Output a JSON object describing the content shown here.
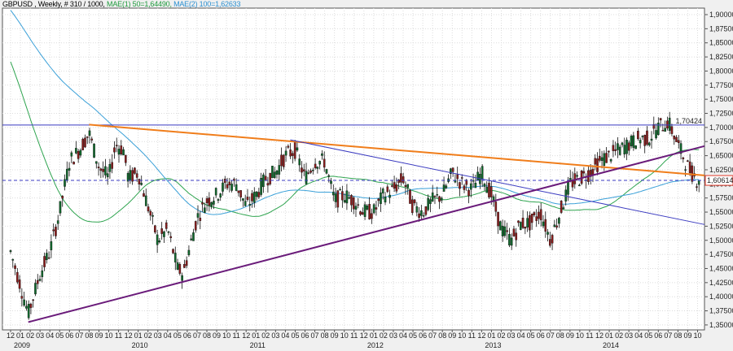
{
  "header": {
    "symbol_info": "GBPUSD , Weekly, # 310 / 1000,",
    "ma1_label": "MAE(1) 50=1,64490,",
    "ma2_label": "MAE(2) 100=1,62633"
  },
  "colors": {
    "bull": "#0f6a2c",
    "bear": "#8a1c1c",
    "ma1": "#2ea44f",
    "ma2": "#3aa0d8",
    "orange": "#f07d1a",
    "purple": "#6a1b7a",
    "blue_line": "#3a3ac0",
    "price_box": "#e03a2a"
  },
  "chart_data": {
    "type": "candlestick",
    "title": "GBPUSD , Weekly",
    "ylim": [
      1.35,
      1.9
    ],
    "y_ticks": [
      "1,35000",
      "1,37500",
      "1,40000",
      "1,42500",
      "1,45000",
      "1,47500",
      "1,50000",
      "1,52500",
      "1,55000",
      "1,57500",
      "1,60000",
      "1,62500",
      "1,65000",
      "1,67500",
      "1,70000",
      "1,72500",
      "1,75000",
      "1,77500",
      "1,80000",
      "1,82500",
      "1,85000",
      "1,87500",
      "1,90000"
    ],
    "x_month_labels": [
      "12",
      "01",
      "02",
      "03",
      "04",
      "05",
      "06",
      "07",
      "08",
      "09",
      "10",
      "11",
      "12",
      "01",
      "02",
      "03",
      "04",
      "05",
      "06",
      "07",
      "08",
      "09",
      "10",
      "11",
      "12",
      "01",
      "02",
      "03",
      "04",
      "05",
      "06",
      "07",
      "08",
      "09",
      "10",
      "11",
      "12",
      "01",
      "02",
      "03",
      "04",
      "05",
      "06",
      "07",
      "08",
      "09",
      "10",
      "11",
      "12",
      "01",
      "02",
      "03",
      "04",
      "05",
      "06",
      "07",
      "08",
      "09",
      "10",
      "11",
      "12",
      "01",
      "02",
      "03",
      "04",
      "05",
      "06",
      "07",
      "08",
      "09",
      "10"
    ],
    "x_year_labels": [
      {
        "label": "2009",
        "month_index": 1
      },
      {
        "label": "2010",
        "month_index": 13
      },
      {
        "label": "2011",
        "month_index": 25
      },
      {
        "label": "2012",
        "month_index": 37
      },
      {
        "label": "2013",
        "month_index": 49
      },
      {
        "label": "2014",
        "month_index": 61
      }
    ],
    "prehistory_closes": [
      [
        -14,
        2.0
      ],
      [
        -10,
        1.99
      ],
      [
        -7,
        1.98
      ],
      [
        -5,
        1.86
      ],
      [
        -3,
        1.7
      ],
      [
        -2,
        1.58
      ],
      [
        -1,
        1.5
      ]
    ],
    "keypoints": [
      [
        0,
        1.48
      ],
      [
        1,
        1.42
      ],
      [
        1.8,
        1.37
      ],
      [
        3,
        1.44
      ],
      [
        4,
        1.48
      ],
      [
        5,
        1.55
      ],
      [
        6,
        1.64
      ],
      [
        7,
        1.66
      ],
      [
        8,
        1.69
      ],
      [
        9,
        1.63
      ],
      [
        10,
        1.61
      ],
      [
        10.7,
        1.67
      ],
      [
        11.5,
        1.66
      ],
      [
        12,
        1.61
      ],
      [
        13,
        1.62
      ],
      [
        14,
        1.56
      ],
      [
        15,
        1.5
      ],
      [
        16,
        1.52
      ],
      [
        17,
        1.45
      ],
      [
        17.6,
        1.44
      ],
      [
        18,
        1.47
      ],
      [
        19,
        1.54
      ],
      [
        20,
        1.57
      ],
      [
        21,
        1.58
      ],
      [
        22,
        1.6
      ],
      [
        23,
        1.6
      ],
      [
        24,
        1.56
      ],
      [
        25,
        1.58
      ],
      [
        26,
        1.61
      ],
      [
        27,
        1.62
      ],
      [
        28,
        1.65
      ],
      [
        29,
        1.66
      ],
      [
        30,
        1.61
      ],
      [
        31,
        1.64
      ],
      [
        32,
        1.64
      ],
      [
        33,
        1.57
      ],
      [
        34,
        1.58
      ],
      [
        35,
        1.57
      ],
      [
        36,
        1.55
      ],
      [
        37,
        1.55
      ],
      [
        38,
        1.58
      ],
      [
        39,
        1.59
      ],
      [
        40,
        1.61
      ],
      [
        41,
        1.56
      ],
      [
        42,
        1.55
      ],
      [
        43,
        1.57
      ],
      [
        44,
        1.58
      ],
      [
        45,
        1.62
      ],
      [
        46,
        1.6
      ],
      [
        47,
        1.59
      ],
      [
        48,
        1.62
      ],
      [
        49,
        1.58
      ],
      [
        50,
        1.52
      ],
      [
        51,
        1.5
      ],
      [
        52,
        1.53
      ],
      [
        53,
        1.53
      ],
      [
        54,
        1.55
      ],
      [
        55,
        1.5
      ],
      [
        56,
        1.55
      ],
      [
        57,
        1.6
      ],
      [
        58,
        1.61
      ],
      [
        59,
        1.62
      ],
      [
        60,
        1.64
      ],
      [
        61,
        1.65
      ],
      [
        62,
        1.66
      ],
      [
        63,
        1.67
      ],
      [
        64,
        1.68
      ],
      [
        65,
        1.68
      ],
      [
        66,
        1.7
      ],
      [
        67,
        1.71
      ],
      [
        68,
        1.67
      ],
      [
        69,
        1.63
      ],
      [
        70,
        1.606
      ]
    ],
    "series": [
      {
        "name": "MAE(1) 50",
        "period": 50,
        "last": 1.6449
      },
      {
        "name": "MAE(2) 100",
        "period": 100,
        "last": 1.62633
      }
    ],
    "horizontal_lines": [
      {
        "value": 1.70424,
        "label": "1,70424",
        "style": "solid"
      },
      {
        "value": 1.60614,
        "label": "1,60614",
        "style": "dashed"
      }
    ],
    "trendlines": [
      {
        "name": "orange-resistance",
        "from": [
          8,
          1.705
        ],
        "to": [
          71,
          1.615
        ]
      },
      {
        "name": "blue-resistance",
        "from": [
          28.5,
          1.678
        ],
        "to": [
          71,
          1.528
        ]
      },
      {
        "name": "purple-support",
        "from": [
          1.8,
          1.355
        ],
        "to": [
          71,
          1.667
        ]
      }
    ]
  }
}
